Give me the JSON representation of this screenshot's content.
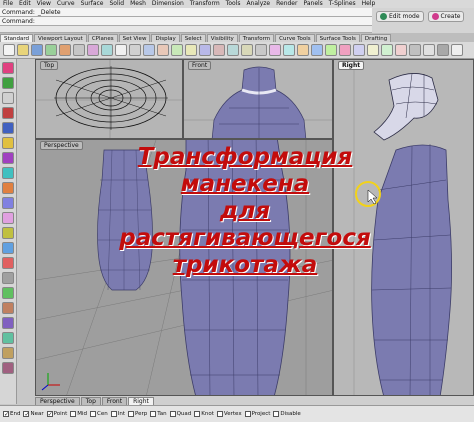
{
  "menu": [
    "File",
    "Edit",
    "View",
    "Curve",
    "Surface",
    "Solid",
    "Mesh",
    "Dimension",
    "Transform",
    "Tools",
    "Analyze",
    "Render",
    "Panels",
    "T-Splines",
    "Help"
  ],
  "command": {
    "line1_label": "Command:",
    "line1_value": "_Delete",
    "line2_label": "Command:"
  },
  "topright": {
    "edit_mode": "Edit mode",
    "create": "Create"
  },
  "tabs": [
    "Standard",
    "Viewport Layout",
    "CPlanes",
    "Set View",
    "Display",
    "Select",
    "Visibility",
    "Transform",
    "Curve Tools",
    "Surface Tools",
    "Drafting"
  ],
  "active_tab": "Standard",
  "viewports": {
    "top": "Top",
    "front": "Front",
    "perspective": "Perspective",
    "right": "Right"
  },
  "overlay_lines": [
    "Трансформация",
    "манекена",
    "для",
    "растягивающегося",
    "трикотажа"
  ],
  "view_tabs": [
    "Perspective",
    "Top",
    "Front",
    "Right"
  ],
  "active_view_tab": "Right",
  "osnaps": [
    {
      "label": "End",
      "checked": true
    },
    {
      "label": "Near",
      "checked": true
    },
    {
      "label": "Point",
      "checked": true
    },
    {
      "label": "Mid",
      "checked": false
    },
    {
      "label": "Cen",
      "checked": false
    },
    {
      "label": "Int",
      "checked": false
    },
    {
      "label": "Perp",
      "checked": false
    },
    {
      "label": "Tan",
      "checked": false
    },
    {
      "label": "Quad",
      "checked": false
    },
    {
      "label": "Knot",
      "checked": false
    },
    {
      "label": "Vertex",
      "checked": false
    },
    {
      "label": "Project",
      "checked": false
    },
    {
      "label": "Disable",
      "checked": false
    }
  ],
  "colors": {
    "mesh": "#7b7bb0",
    "mesh_dark": "#3c3c68",
    "overlay_text": "#c30c0c",
    "cursor_ring": "#f2d21a"
  }
}
